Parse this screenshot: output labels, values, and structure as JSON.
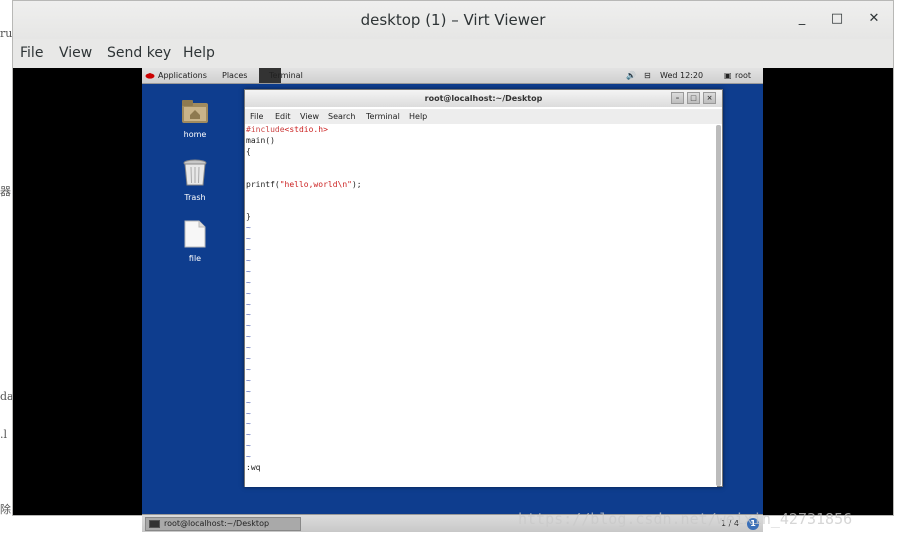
{
  "window": {
    "title": "desktop (1) – Virt Viewer",
    "controls": {
      "minimize": "_",
      "maximize": "□",
      "close": "✕"
    }
  },
  "menubar": [
    "File",
    "View",
    "Send key",
    "Help"
  ],
  "background_page": {
    "fragments": [
      "ru",
      "器",
      "da",
      ".l",
      "除"
    ]
  },
  "guest": {
    "topbar": {
      "applications": "Applications",
      "places": "Places",
      "terminal": "Terminal",
      "datetime": "Wed 12:20",
      "user": "root"
    },
    "desktop_icons": [
      {
        "label": "home",
        "icon": "folder-home-icon"
      },
      {
        "label": "Trash",
        "icon": "trash-icon"
      },
      {
        "label": "file",
        "icon": "file-icon"
      }
    ],
    "terminal": {
      "title": "root@localhost:~/Desktop",
      "menu": [
        "File",
        "Edit",
        "View",
        "Search",
        "Terminal",
        "Help"
      ],
      "lines": {
        "l1_a": "#include",
        "l1_b": "<stdio.h>",
        "l2": "main()",
        "l3": "{",
        "l4": "",
        "l5": "",
        "l6_a": "printf(",
        "l6_b": "\"hello,world\\n\"",
        "l6_c": ");",
        "l7": "",
        "l8": "",
        "l9": "}",
        "command": ":wq"
      },
      "tilde_count": 22
    },
    "taskbar": {
      "item": "root@localhost:~/Desktop",
      "pager": "1 / 4",
      "notification": "1"
    }
  },
  "watermark": "https://blog.csdn.net/weixin_42731856",
  "colors": {
    "desktop": "#0e3d8e",
    "viewer_chrome": "#e8e8e7",
    "keyword": "#cc4444",
    "tilde": "#4b5fb4"
  }
}
